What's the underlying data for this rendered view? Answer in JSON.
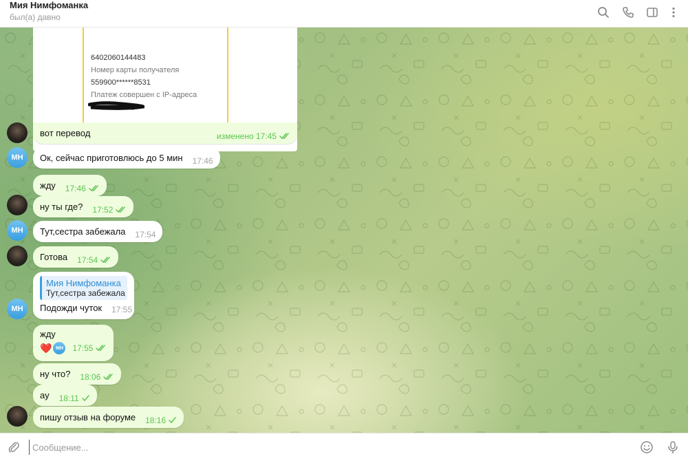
{
  "header": {
    "title": "Мия Нимфоманка",
    "status": "был(а) давно",
    "icons": [
      "search-icon",
      "phone-icon",
      "sidebar-toggle-icon",
      "more-vertical-icon"
    ]
  },
  "receipt": {
    "number_value": "6402060144483",
    "card_label": "Номер карты получателя",
    "card_value": "559900******8531",
    "ip_label": "Платеж совершен с IP-адреса"
  },
  "messages": [
    {
      "dir": "out",
      "avatar": "me",
      "text": "вот перевод",
      "time": "изменено 17:45",
      "status": "read"
    },
    {
      "dir": "in",
      "avatar": "МН",
      "text": "Ок, сейчас приготовлюсь до 5 мин",
      "time": "17:46"
    },
    {
      "dir": "out",
      "text": "жду",
      "time": "17:46",
      "status": "read"
    },
    {
      "dir": "out",
      "avatar": "me",
      "text": "ну ты где?",
      "time": "17:52",
      "status": "read"
    },
    {
      "dir": "in",
      "avatar": "МН",
      "text": "Тут,сестра забежала",
      "time": "17:54"
    },
    {
      "dir": "out",
      "avatar": "me",
      "text": "Готова",
      "time": "17:54",
      "status": "read"
    },
    {
      "dir": "in",
      "avatar": "МН",
      "reply_name": "Мия Нимфоманка",
      "reply_text": "Тут,сестра забежала",
      "text": "Подожди чуток",
      "time": "17:55"
    },
    {
      "dir": "out",
      "text": "жду",
      "time": "17:55",
      "status": "read",
      "reaction": "❤️",
      "reaction_user": "МН"
    },
    {
      "dir": "out",
      "text": "ну что?",
      "time": "18:06",
      "status": "read"
    },
    {
      "dir": "out",
      "text": "ау",
      "time": "18:11",
      "status": "sent"
    },
    {
      "dir": "out",
      "avatar": "me",
      "text": "пишу отзыв на форуме",
      "time": "18:16",
      "status": "sent"
    }
  ],
  "composer": {
    "placeholder": "Сообщение...",
    "icons": [
      "attach-icon",
      "emoji-icon",
      "microphone-icon"
    ]
  },
  "colors": {
    "outgoing_bubble": "#effdde",
    "incoming_bubble": "#ffffff",
    "check_green": "#5dc452",
    "accent_blue": "#3aa0e0",
    "receipt_border": "#f0cf35"
  }
}
